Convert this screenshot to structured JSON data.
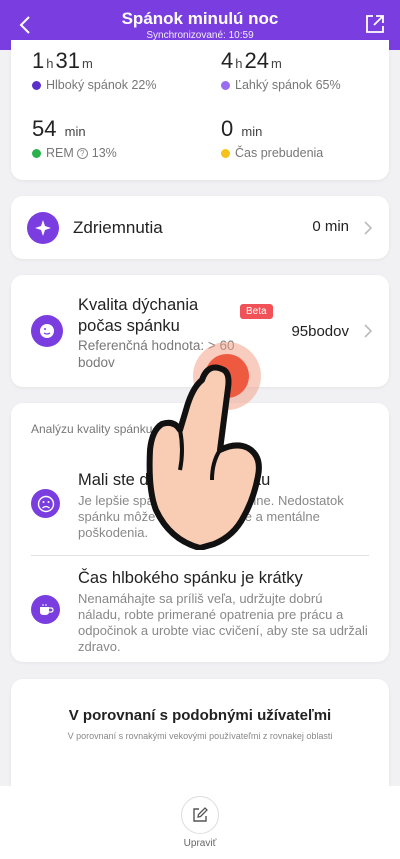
{
  "header": {
    "title": "Spánok minulú noc",
    "subtitle": "Synchronizované: 10:59",
    "bg_color": "#7a3ee0",
    "back_icon": "chevron-left-icon",
    "share_icon": "share-icon"
  },
  "stats": {
    "deep": {
      "h": "1",
      "h_unit": "h",
      "m": "31",
      "m_unit": "m",
      "label": "Hlboký spánok 22%",
      "color": "#5b2fc9"
    },
    "light": {
      "h": "4",
      "h_unit": "h",
      "m": "24",
      "m_unit": "m",
      "label": "Ľahký spánok 65%",
      "color": "#9a6cf0"
    },
    "rem": {
      "val": "54",
      "unit": "min",
      "label_a": "REM",
      "label_b": "13%",
      "color": "#2bb24c"
    },
    "awake": {
      "val": "0",
      "unit": "min",
      "label": "Čas prebudenia",
      "color": "#f4c21a"
    }
  },
  "nap": {
    "label": "Zdriemnutia",
    "value": "0 min",
    "icon": "sparkle-icon"
  },
  "breathing": {
    "title": "Kvalita dýchania počas spánku",
    "badge": "Beta",
    "reference": "Referenčná hodnota: > 60 bodov",
    "value": "95bodov",
    "icon": "face-breath-icon"
  },
  "analysis": {
    "heading": "Analýzu kvality spánku",
    "items": [
      {
        "title": "Mali ste dosť málo spánku",
        "desc": "Je lepšie spať dlhšie a pravidelne. Nedostatok spánku môže spôsobiť fyzické a mentálne poškodenia.",
        "icon": "sad-face-icon"
      },
      {
        "title": "Čas hlbokého spánku je krátky",
        "desc": "Nenamáhajte sa príliš veľa, udržujte dobrú náladu, robte primerané opatrenia pre prácu a odpočinok a urobte viac cvičení, aby ste sa udržali zdravo.",
        "icon": "coffee-cup-icon"
      }
    ]
  },
  "compare": {
    "title": "V porovnaní s podobnými užívateľmi",
    "desc": "V porovnaní s rovnakými vekovými používateľmi z rovnakej oblasti"
  },
  "bottom": {
    "edit_label": "Upraviť",
    "icon": "edit-icon"
  }
}
